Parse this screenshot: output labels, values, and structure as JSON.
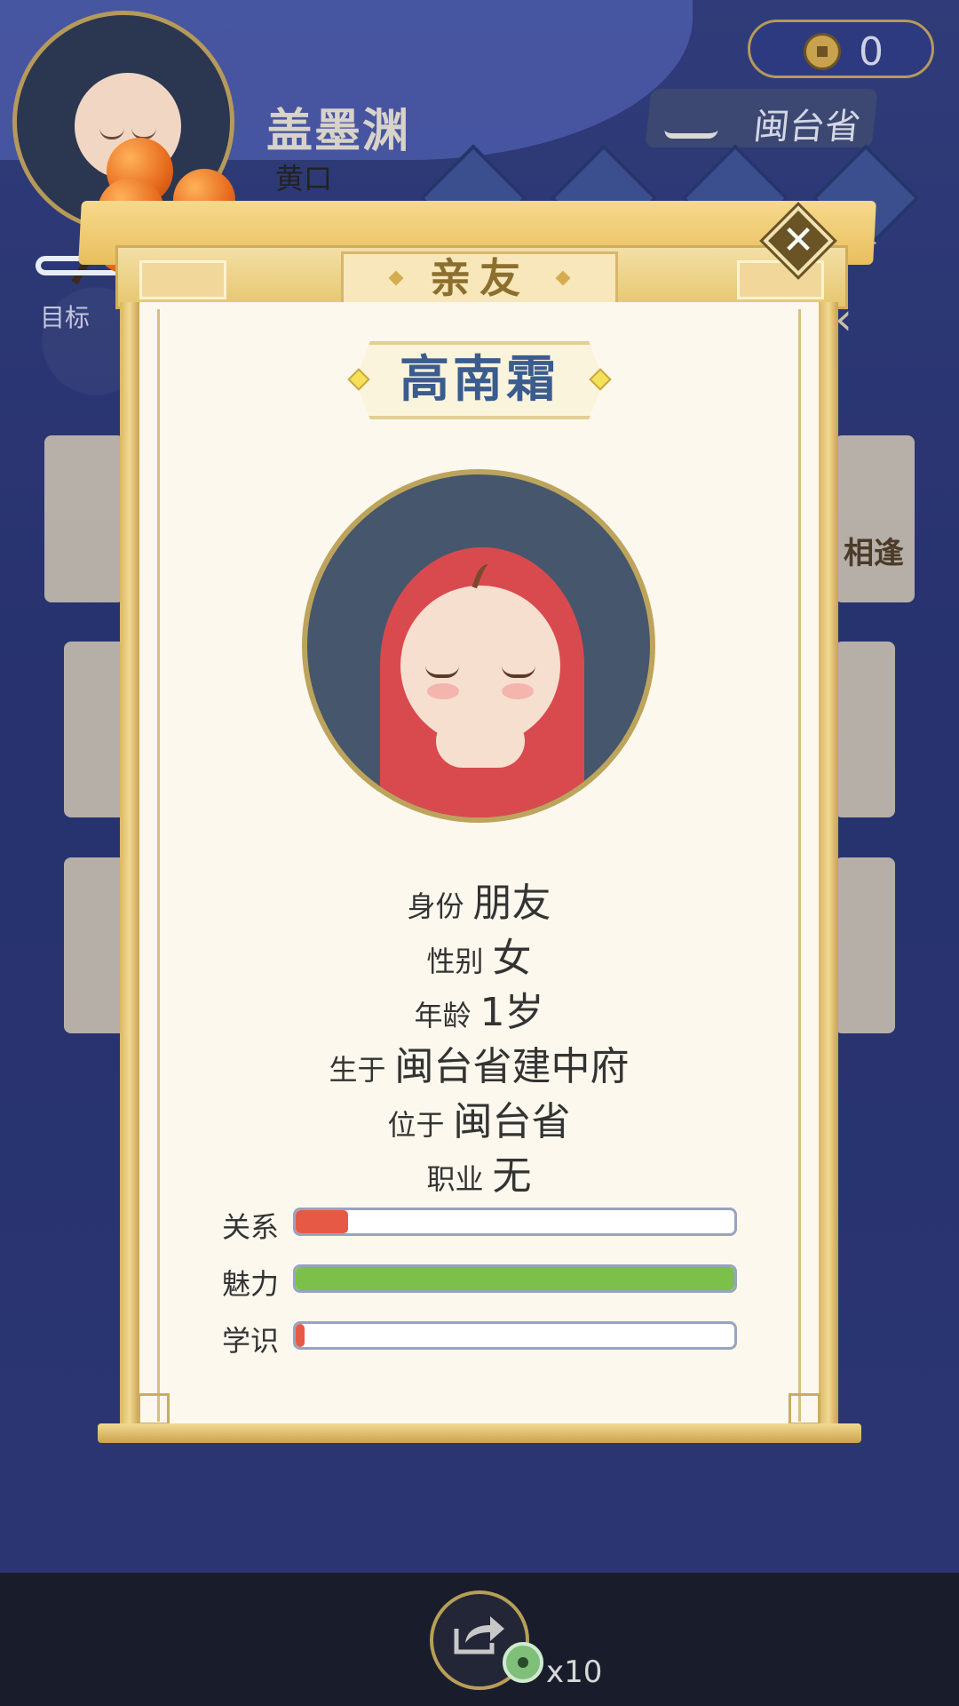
{
  "hud": {
    "player_name": "盖墨渊",
    "player_age": "黄口",
    "coins": "0",
    "location": "闽台省",
    "goal_label": "目标",
    "list_label": "单",
    "side_text": "相逢"
  },
  "modal": {
    "title": "亲友",
    "name": "高南霜",
    "info": [
      {
        "key": "身份",
        "value": "朋友"
      },
      {
        "key": "性别",
        "value": "女"
      },
      {
        "key": "年龄",
        "value": "1岁"
      },
      {
        "key": "生于",
        "value": "闽台省建中府"
      },
      {
        "key": "位于",
        "value": "闽台省"
      },
      {
        "key": "职业",
        "value": "无"
      }
    ],
    "stats": [
      {
        "label": "关系",
        "fraction": 0.12,
        "color": "#e65a45"
      },
      {
        "label": "魅力",
        "fraction": 1.0,
        "color": "#7cc04b"
      },
      {
        "label": "学识",
        "fraction": 0.02,
        "color": "#e65a45"
      }
    ]
  },
  "bottom": {
    "reward": "x10"
  },
  "icons": {
    "close": "close-icon",
    "share": "share-icon",
    "coin": "coin-icon",
    "reward": "jade-icon"
  }
}
